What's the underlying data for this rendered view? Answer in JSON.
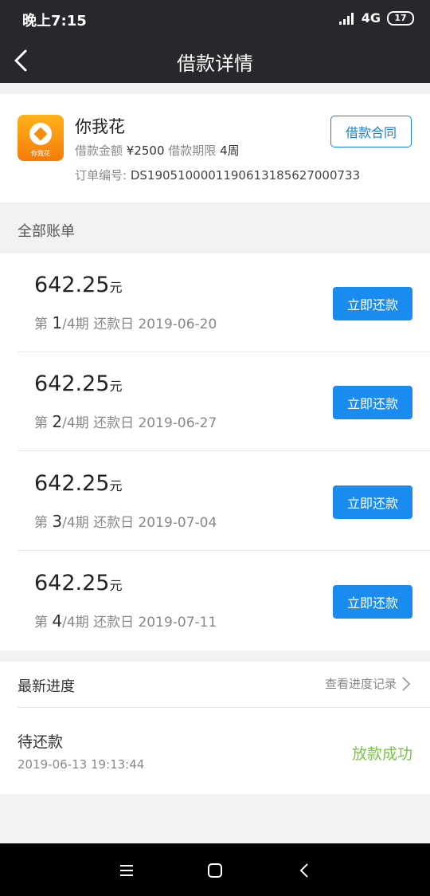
{
  "status_bar": {
    "time": "晚上7:15",
    "network": "4G",
    "battery": "17"
  },
  "nav": {
    "title": "借款详情",
    "back_icon": "back-chevron-icon"
  },
  "loan": {
    "app_name": "你我花",
    "logo_text": "你我花",
    "amount_label": "借款金额",
    "amount_value": "¥2500",
    "term_label": "借款期限",
    "term_value": "4周",
    "order_label": "订单编号:",
    "order_value": "DS190510000119061318562700073​3",
    "contract_button": "借款合同"
  },
  "bills_section": {
    "title": "全部账单"
  },
  "bills": [
    {
      "amount": "642.25",
      "unit": "元",
      "prefix": "第 ",
      "index": "1",
      "suffix": "/4期 还款日 2019-06-20",
      "button": "立即还款"
    },
    {
      "amount": "642.25",
      "unit": "元",
      "prefix": "第 ",
      "index": "2",
      "suffix": "/4期 还款日 2019-06-27",
      "button": "立即还款"
    },
    {
      "amount": "642.25",
      "unit": "元",
      "prefix": "第 ",
      "index": "3",
      "suffix": "/4期 还款日 2019-07-04",
      "button": "立即还款"
    },
    {
      "amount": "642.25",
      "unit": "元",
      "prefix": "第 ",
      "index": "4",
      "suffix": "/4期 还款日 2019-07-11",
      "button": "立即还款"
    }
  ],
  "progress": {
    "title": "最新进度",
    "record_link": "查看进度记录",
    "state": "待还款",
    "timestamp": "2019-06-13 19:13:44",
    "result": "放款成功"
  },
  "colors": {
    "primary": "#1a8cf0",
    "success": "#7cc34a",
    "header": "#26282b"
  }
}
